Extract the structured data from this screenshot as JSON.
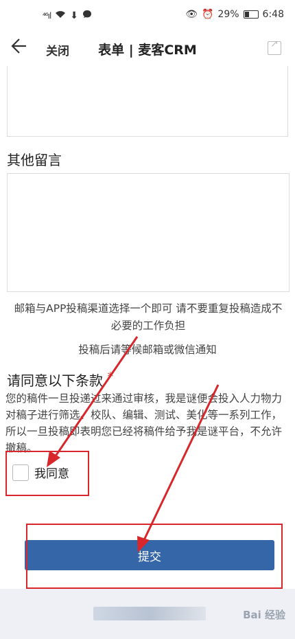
{
  "status_bar": {
    "signal": "⁴⁶ıl",
    "battery_percent": "29%",
    "time": "6:48"
  },
  "nav": {
    "close_label": "关闭",
    "title": "表单 | 麦客CRM"
  },
  "form": {
    "other_message_label": "其他留言",
    "notice_line1": "邮箱与APP投稿渠道选择一个即可 请不要重复投稿造成不必要的工作负担",
    "notice_line2": "投稿后请等候邮箱或微信通知",
    "terms_title": "请同意以下条款",
    "required_mark": "*",
    "terms_text": "您的稿件一旦投递过来通过审核，我是谜便会投入人力物力对稿子进行筛选、校队、编辑、测试、美化等一系列工作，所以一旦投稿即表明您已经将稿件给予我是谜平台，不允许撤稿。",
    "agree_label": "我同意",
    "agree_checked": false,
    "submit_label": "提交"
  },
  "watermark": "Bai 经验",
  "colors": {
    "submit_bg": "#3567a8",
    "annotation_red": "#d8262b",
    "required_star": "#e0453a"
  }
}
